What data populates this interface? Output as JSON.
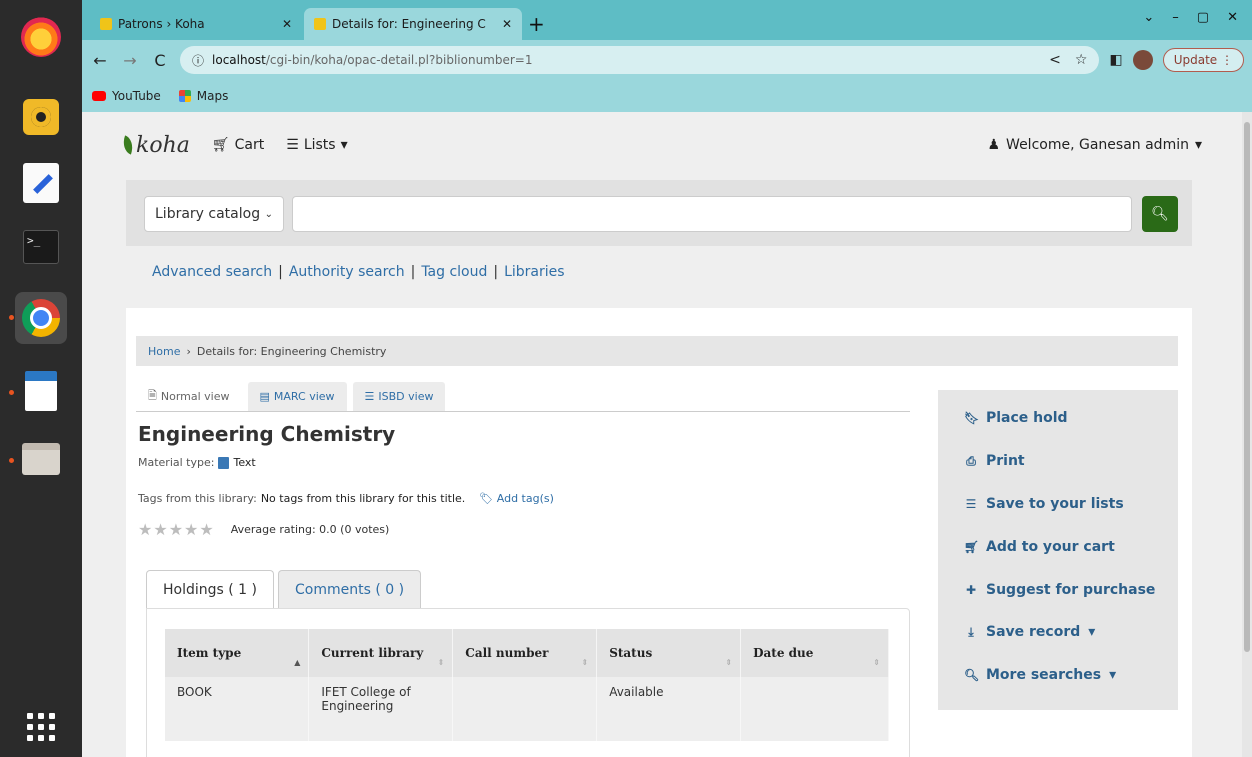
{
  "browser": {
    "tabs": [
      {
        "title": "Patrons › Koha"
      },
      {
        "title": "Details for: Engineering C"
      }
    ],
    "url_host": "localhost",
    "url_path": "/cgi-bin/koha/opac-detail.pl?biblionumber=1",
    "update_label": "Update",
    "bookmarks": [
      "YouTube",
      "Maps"
    ]
  },
  "dock": {
    "terminal_prompt": ">_"
  },
  "opac": {
    "logo": "koha",
    "cart_label": "Cart",
    "lists_label": "Lists",
    "welcome": "Welcome, Ganesan admin",
    "search": {
      "catalog_selected": "Library catalog",
      "query": ""
    },
    "adv_links": [
      "Advanced search",
      "Authority search",
      "Tag cloud",
      "Libraries"
    ],
    "adv_sep": "|",
    "breadcrumb": {
      "home": "Home",
      "current": "Details for: Engineering Chemistry"
    },
    "view_tabs": [
      "Normal view",
      "MARC view",
      "ISBD view"
    ],
    "record": {
      "title": "Engineering Chemistry",
      "material_type_label": "Material type:",
      "material_type": "Text",
      "tags_label": "Tags from this library:",
      "tags_value": "No tags from this library for this title.",
      "add_tags": "Add tag(s)",
      "rating_label": "Average rating: 0.0 (0 votes)",
      "rating_value": 0
    },
    "holding_tabs": [
      "Holdings ( 1 )",
      "Comments ( 0 )"
    ],
    "holdings": {
      "columns": [
        "Item type",
        "Current library",
        "Call number",
        "Status",
        "Date due"
      ],
      "rows": [
        [
          "BOOK",
          "IFET College of Engineering",
          "",
          "Available",
          ""
        ]
      ]
    },
    "actions": [
      "Place hold",
      "Print",
      "Save to your lists",
      "Add to your cart",
      "Suggest for purchase",
      "Save record",
      "More searches"
    ]
  }
}
